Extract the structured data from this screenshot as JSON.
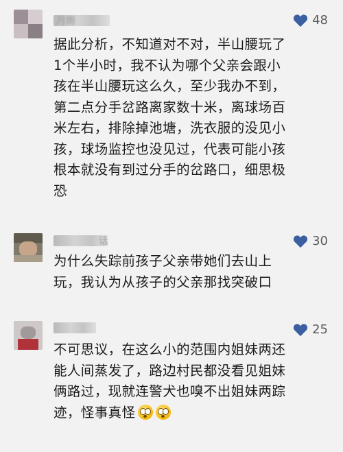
{
  "comments": [
    {
      "username": "月雨",
      "likes": "48",
      "text": "据此分析，不知道对不对，半山腰玩了\n1个半小时，我不认为哪个父亲会跟小\n孩在半山腰玩这么久，至少我办不到，\n第二点分手岔路离家数十米，离球场百\n米左右，排除掉池塘，洗衣服的没见小\n孩，球场监控也没见过，代表可能小孩\n根本就没有到过分手的岔路口，细思极\n恐"
    },
    {
      "username": "话",
      "likes": "30",
      "text": "为什么失踪前孩子父亲带她们去山上\n玩，我认为从孩子的父亲那找突破口"
    },
    {
      "username": "",
      "likes": "25",
      "text": "不可思议，在这么小的范围内姐妹两还\n能人间蒸发了，路边村民都没看见姐妹\n俩路过，现就连警犬也嗅不出姐妹两踪\n迹，怪事真怪",
      "emojis": [
        "flushed-face-emoji",
        "flushed-face-emoji"
      ]
    }
  ],
  "colors": {
    "heart": "#3b5fa0",
    "background": "#f2f2f2",
    "text": "#1c1c1c"
  }
}
